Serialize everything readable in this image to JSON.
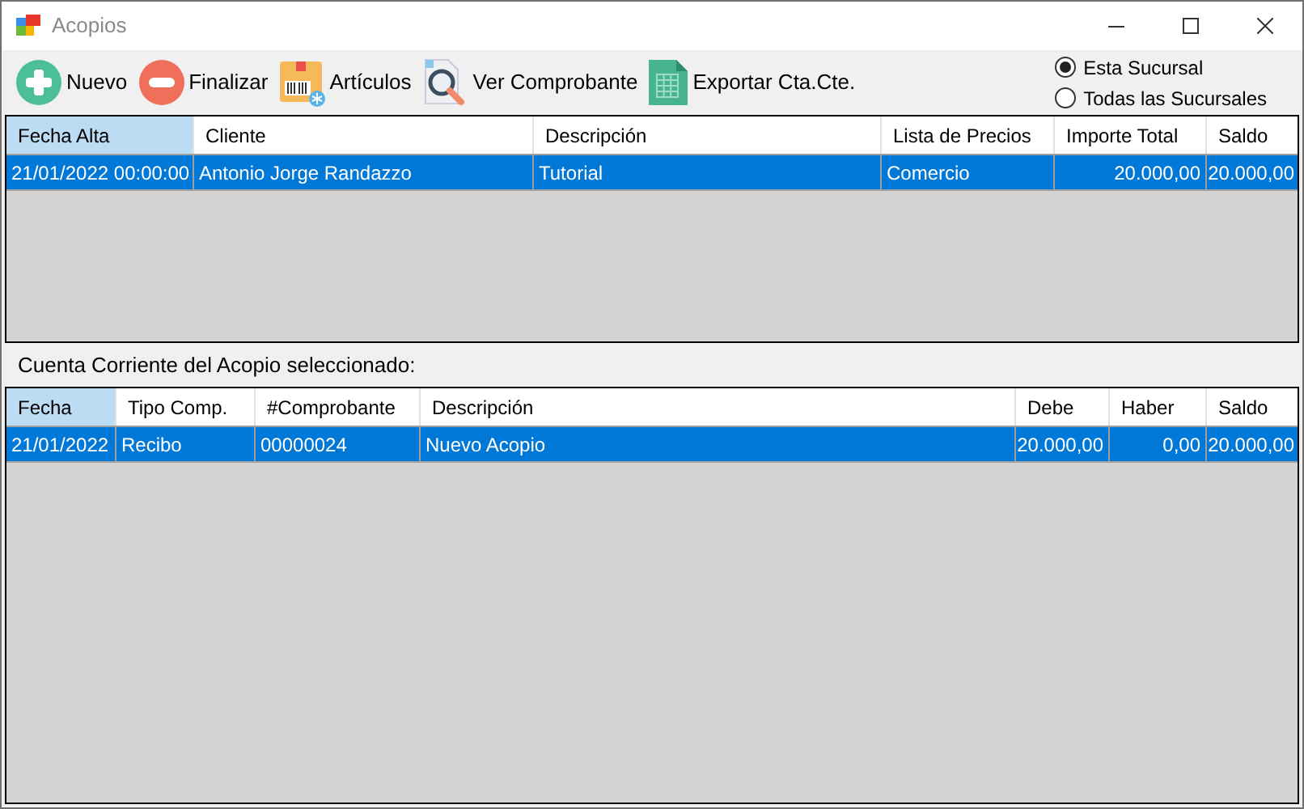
{
  "window": {
    "title": "Acopios"
  },
  "toolbar": [
    {
      "kind": "plus",
      "label": "Nuevo"
    },
    {
      "kind": "minus",
      "label": "Finalizar"
    },
    {
      "kind": "box",
      "label": "Artículos"
    },
    {
      "kind": "search",
      "label": "Ver Comprobante"
    },
    {
      "kind": "sheet",
      "label": "Exportar Cta.Cte."
    }
  ],
  "scope": [
    {
      "label": "Esta Sucursal",
      "selected": true
    },
    {
      "label": "Todas las Sucursales",
      "selected": false
    }
  ],
  "acopios_table": {
    "columns": [
      {
        "label": "Fecha Alta",
        "kind": "text",
        "selected": true
      },
      {
        "label": "Cliente",
        "kind": "text",
        "selected": false
      },
      {
        "label": "Descripción",
        "kind": "text",
        "selected": false
      },
      {
        "label": "Lista de Precios",
        "kind": "text",
        "selected": false
      },
      {
        "label": "Importe Total",
        "kind": "amount",
        "selected": false
      },
      {
        "label": "Saldo",
        "kind": "amount",
        "selected": false
      }
    ],
    "rows": [
      {
        "selected": true,
        "cells": [
          "21/01/2022 00:00:00",
          "Antonio Jorge Randazzo",
          "Tutorial",
          "Comercio",
          "20.000,00",
          "20.000,00"
        ]
      }
    ]
  },
  "section_label": "Cuenta Corriente del Acopio seleccionado:",
  "cuenta_table": {
    "columns": [
      {
        "label": "Fecha",
        "kind": "text",
        "selected": true
      },
      {
        "label": "Tipo Comp.",
        "kind": "text",
        "selected": false
      },
      {
        "label": "#Comprobante",
        "kind": "text",
        "selected": false
      },
      {
        "label": "Descripción",
        "kind": "text",
        "selected": false
      },
      {
        "label": "Debe",
        "kind": "amount",
        "selected": false
      },
      {
        "label": "Haber",
        "kind": "amount",
        "selected": false
      },
      {
        "label": "Saldo",
        "kind": "amount",
        "selected": false
      }
    ],
    "rows": [
      {
        "selected": true,
        "cells": [
          "21/01/2022",
          "Recibo",
          "00000024",
          "Nuevo Acopio",
          "20.000,00",
          "0,00",
          "20.000,00"
        ]
      }
    ]
  }
}
